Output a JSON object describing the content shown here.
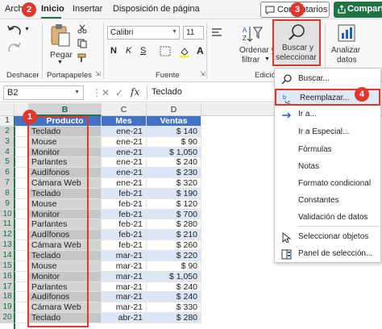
{
  "tabs": [
    {
      "label": "Arch"
    },
    {
      "label": "Inicio"
    },
    {
      "label": "Insertar"
    },
    {
      "label": "Disposición de página"
    }
  ],
  "comments_button": "Comentarios",
  "share_button": "Compartir",
  "badges": [
    "1",
    "2",
    "3",
    "4"
  ],
  "ribbon": {
    "undo_label": "Deshacer",
    "paste_label": "Pegar",
    "clipboard_label": "Portapapeles",
    "font_name": "Calibri",
    "font_size": "11",
    "font_group_label": "Fuente",
    "sort_filter_label_1": "Ordenar y",
    "sort_filter_label_2": "filtrar",
    "find_select_label_1": "Buscar y",
    "find_select_label_2": "seleccionar",
    "analyze_label_1": "Analizar",
    "analyze_label_2": "datos",
    "editing_group_label": "Edició",
    "bold": "N",
    "italic": "K",
    "underline": "S",
    "colors": {
      "accent": "#217346",
      "highlight": "#e0372d",
      "table_header": "#4472c4"
    }
  },
  "formula_bar": {
    "name_box": "B2",
    "fx": "fx",
    "value": "Teclado"
  },
  "columns": [
    "B",
    "C",
    "D"
  ],
  "row_numbers": [
    "1",
    "2",
    "3",
    "4",
    "5",
    "6",
    "7",
    "8",
    "9",
    "10",
    "11",
    "12",
    "13",
    "14",
    "15",
    "16",
    "17",
    "18",
    "19",
    "20"
  ],
  "table": {
    "headers": [
      "Producto",
      "Mes",
      "Ventas"
    ],
    "rows": [
      [
        "Teclado",
        "ene-21",
        "$ 140"
      ],
      [
        "Mouse",
        "ene-21",
        "$ 90"
      ],
      [
        "Monitor",
        "ene-21",
        "$ 1,050"
      ],
      [
        "Parlantes",
        "ene-21",
        "$ 240"
      ],
      [
        "Audífonos",
        "ene-21",
        "$ 230"
      ],
      [
        "Cámara Web",
        "ene-21",
        "$ 320"
      ],
      [
        "Teclado",
        "feb-21",
        "$ 190"
      ],
      [
        "Mouse",
        "feb-21",
        "$ 120"
      ],
      [
        "Monitor",
        "feb-21",
        "$ 700"
      ],
      [
        "Parlantes",
        "feb-21",
        "$ 280"
      ],
      [
        "Audífonos",
        "feb-21",
        "$ 210"
      ],
      [
        "Cámara Web",
        "feb-21",
        "$ 260"
      ],
      [
        "Teclado",
        "mar-21",
        "$ 220"
      ],
      [
        "Mouse",
        "mar-21",
        "$ 90"
      ],
      [
        "Monitor",
        "mar-21",
        "$ 1,050"
      ],
      [
        "Parlantes",
        "mar-21",
        "$ 240"
      ],
      [
        "Audífonos",
        "mar-21",
        "$ 240"
      ],
      [
        "Cámara Web",
        "mar-21",
        "$ 330"
      ],
      [
        "Teclado",
        "abr-21",
        "$ 280"
      ]
    ]
  },
  "menu": {
    "items": [
      {
        "label": "Buscar...",
        "icon": "search-icon"
      },
      {
        "label": "Reemplazar...",
        "icon": "replace-icon"
      },
      {
        "label": "Ir a...",
        "icon": "goto-arrow-icon"
      },
      {
        "label": "Ir a Especial...",
        "icon": ""
      },
      {
        "label": "Fórmulas",
        "icon": ""
      },
      {
        "label": "Notas",
        "icon": ""
      },
      {
        "label": "Formato condicional",
        "icon": ""
      },
      {
        "label": "Constantes",
        "icon": ""
      },
      {
        "label": "Validación de datos",
        "icon": ""
      },
      {
        "label": "Seleccionar objetos",
        "icon": "cursor-arrow-icon"
      },
      {
        "label": "Panel de selección...",
        "icon": "selection-pane-icon"
      }
    ]
  }
}
